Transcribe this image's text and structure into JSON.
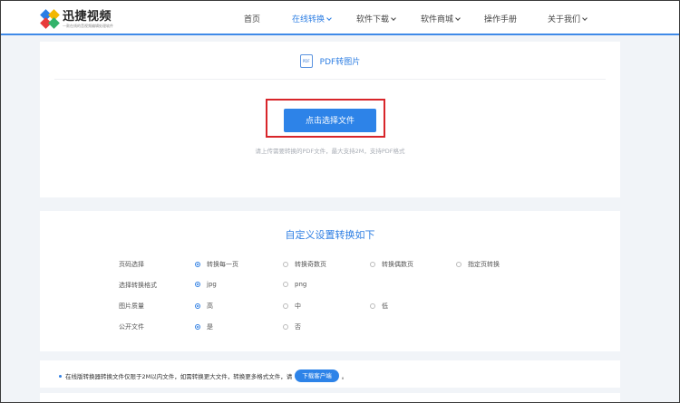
{
  "header": {
    "logo": {
      "title": "迅捷视频",
      "subtitle": "一款在线的音视频编辑处理软件"
    },
    "nav": [
      {
        "label": "首页",
        "active": false,
        "dropdown": false
      },
      {
        "label": "在线转换",
        "active": true,
        "dropdown": true
      },
      {
        "label": "软件下载",
        "active": false,
        "dropdown": true
      },
      {
        "label": "软件商城",
        "active": false,
        "dropdown": true
      },
      {
        "label": "操作手册",
        "active": false,
        "dropdown": false
      },
      {
        "label": "关于我们",
        "active": false,
        "dropdown": true
      }
    ]
  },
  "converter": {
    "tab_icon_text": "PDF",
    "tab_label": "PDF转图片",
    "upload_label": "点击选择文件",
    "hint": "请上传需要转换的PDF文件，最大支持2M，支持PDF格式"
  },
  "settings": {
    "title": "自定义设置转换如下",
    "rows": [
      {
        "label": "页码选择",
        "options": [
          "转换每一页",
          "转换奇数页",
          "转换偶数页",
          "指定页转换"
        ],
        "selected": 0
      },
      {
        "label": "选择转换格式",
        "options": [
          "jpg",
          "png"
        ],
        "selected": 0
      },
      {
        "label": "图片质量",
        "options": [
          "高",
          "中",
          "低"
        ],
        "selected": 0
      },
      {
        "label": "公开文件",
        "options": [
          "是",
          "否"
        ],
        "selected": 0
      }
    ]
  },
  "notice": {
    "text_before": "在线版转换器转换文件仅限于2M以内文件，如需转换更大文件，转换更多格式文件，请",
    "button": "下载客户端",
    "text_after": "。"
  },
  "colors": {
    "accent": "#2d83e8",
    "highlight_border": "#d8252a",
    "background": "#f1f4f8"
  }
}
